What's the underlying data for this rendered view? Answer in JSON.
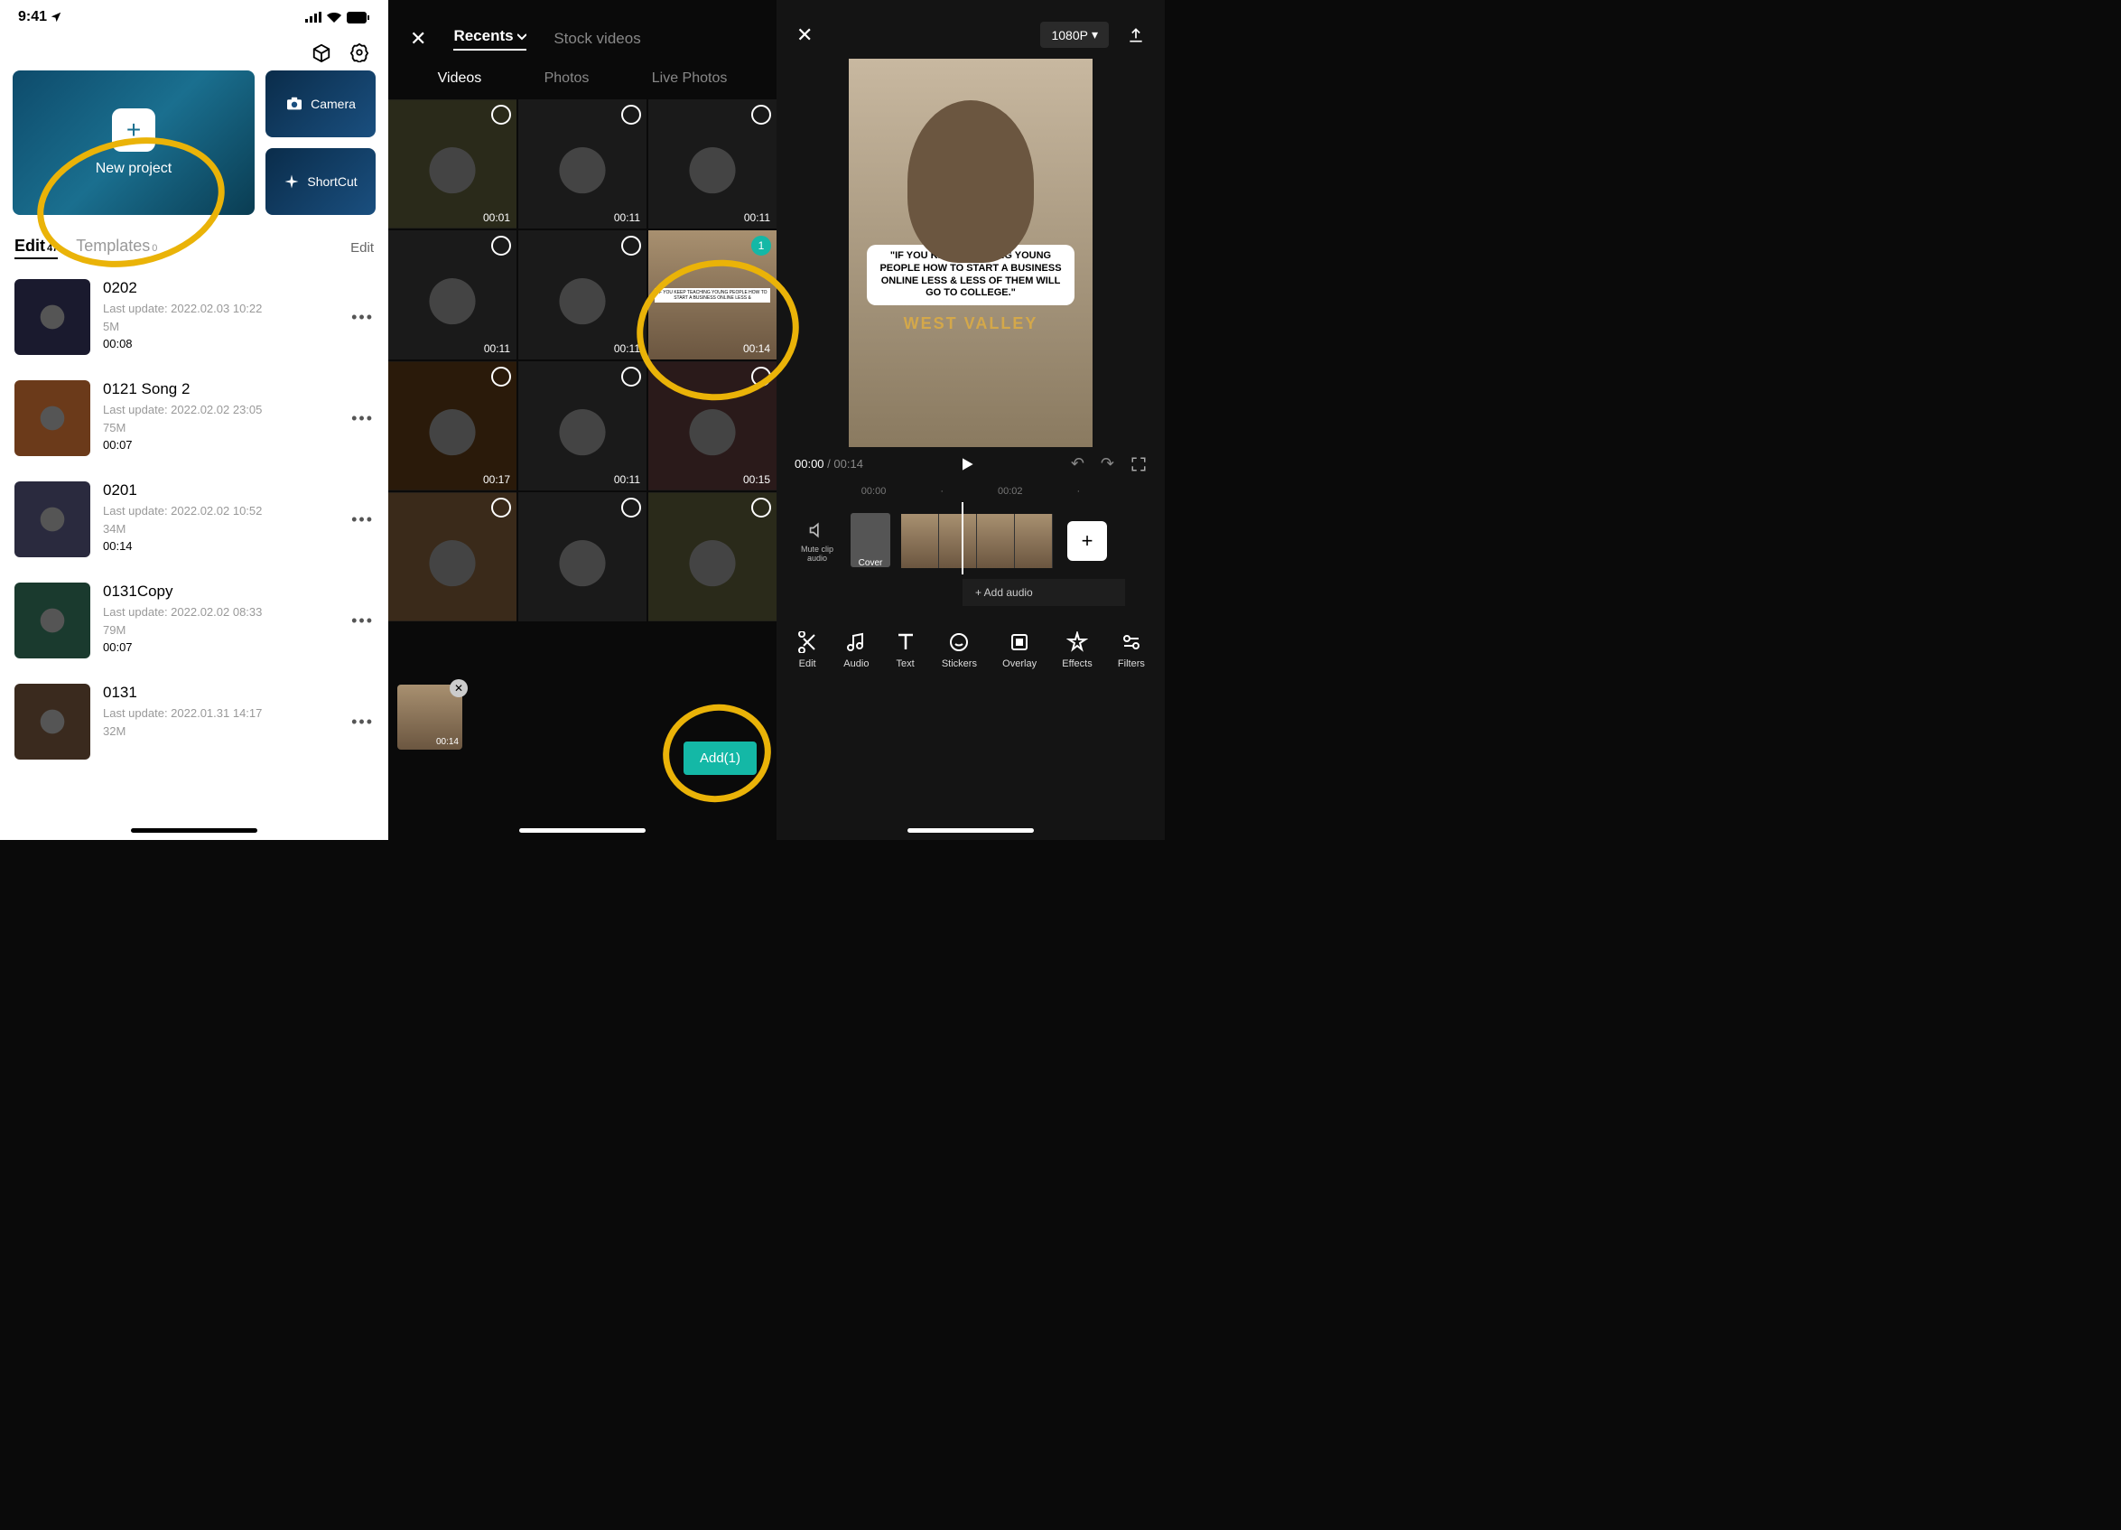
{
  "panel1": {
    "status_time": "9:41",
    "new_project": "New project",
    "camera": "Camera",
    "shortcut": "ShortCut",
    "tab_edit": "Edit",
    "tab_edit_count": "47",
    "tab_templates": "Templates",
    "tab_templates_count": "0",
    "edit_link": "Edit",
    "projects": [
      {
        "title": "0202",
        "meta": "Last update: 2022.02.03 10:22",
        "size": "5M",
        "dur": "00:08"
      },
      {
        "title": "0121 Song 2",
        "meta": "Last update: 2022.02.02 23:05",
        "size": "75M",
        "dur": "00:07"
      },
      {
        "title": "0201",
        "meta": "Last update: 2022.02.02 10:52",
        "size": "34M",
        "dur": "00:14"
      },
      {
        "title": "0131Copy",
        "meta": "Last update: 2022.02.02 08:33",
        "size": "79M",
        "dur": "00:07"
      },
      {
        "title": "0131",
        "meta": "Last update: 2022.01.31 14:17",
        "size": "32M",
        "dur": ""
      }
    ]
  },
  "panel2": {
    "tab_recents": "Recents",
    "tab_stock": "Stock videos",
    "sub_videos": "Videos",
    "sub_photos": "Photos",
    "sub_live": "Live Photos",
    "cells": [
      {
        "time": "00:01",
        "sel": false
      },
      {
        "time": "00:11",
        "sel": false
      },
      {
        "time": "00:11",
        "sel": false
      },
      {
        "time": "00:11",
        "sel": false
      },
      {
        "time": "00:11",
        "sel": false
      },
      {
        "time": "00:14",
        "sel": true,
        "badge": "1"
      },
      {
        "time": "00:17",
        "sel": false
      },
      {
        "time": "00:11",
        "sel": false
      },
      {
        "time": "00:15",
        "sel": false
      },
      {
        "time": "",
        "sel": false
      },
      {
        "time": "",
        "sel": false
      },
      {
        "time": "",
        "sel": false
      }
    ],
    "sel_time": "00:14",
    "add_btn": "Add(1)",
    "thumb_caption": "IF YOU KEEP TEACHING YOUNG PEOPLE HOW TO START A BUSINESS ONLINE LESS &"
  },
  "panel3": {
    "resolution": "1080P",
    "caption": "\"IF YOU KEEP TEACHING YOUNG PEOPLE HOW TO START A BUSINESS ONLINE LESS & LESS OF THEM WILL GO TO COLLEGE.\"",
    "sweater": "WEST VALLEY",
    "time_cur": "00:00",
    "time_total": "00:14",
    "ruler": [
      "00:00",
      "00:02"
    ],
    "mute": "Mute clip audio",
    "cover": "Cover",
    "add_audio": "+  Add audio",
    "tools": [
      {
        "icon": "scissors",
        "label": "Edit"
      },
      {
        "icon": "note",
        "label": "Audio"
      },
      {
        "icon": "T",
        "label": "Text"
      },
      {
        "icon": "circle",
        "label": "Stickers"
      },
      {
        "icon": "layers",
        "label": "Overlay"
      },
      {
        "icon": "star",
        "label": "Effects"
      },
      {
        "icon": "sliders",
        "label": "Filters"
      }
    ]
  }
}
